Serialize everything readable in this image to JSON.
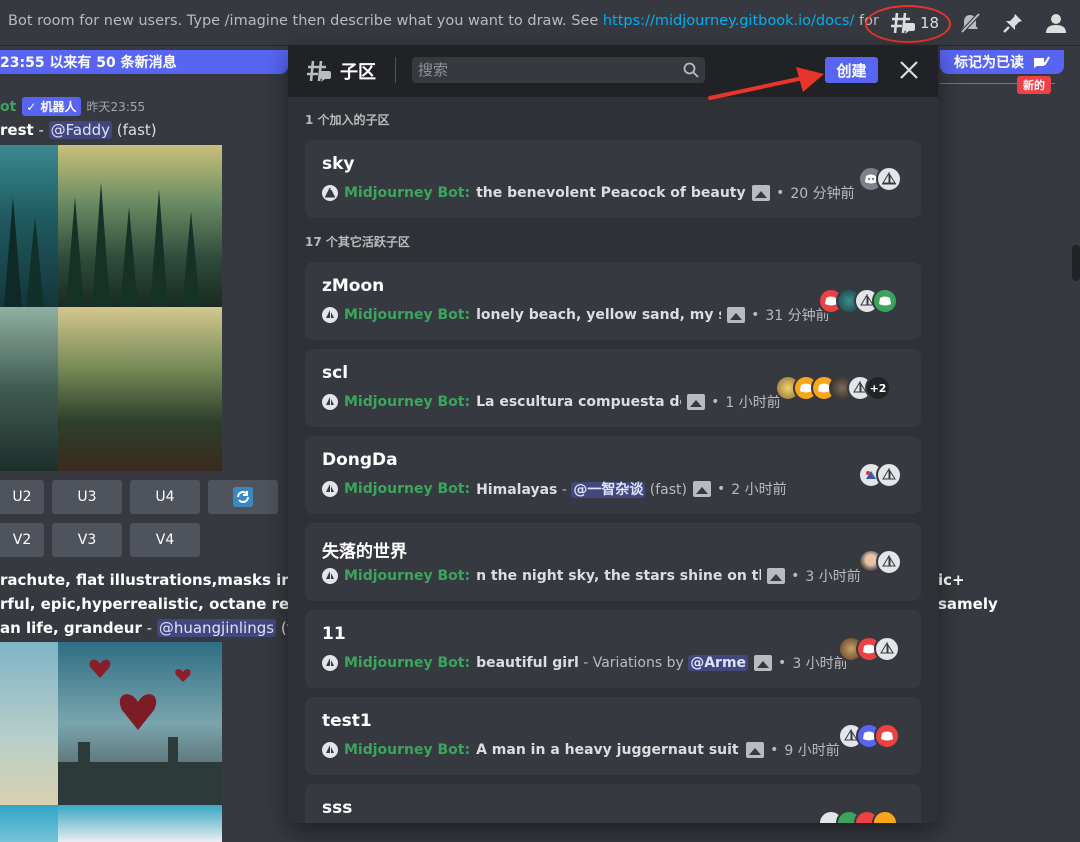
{
  "topbar": {
    "topic_text": "Bot room for new users. Type /imagine then describe what you want to draw. See ",
    "topic_link": "https://midjourney.gitbook.io/docs/",
    "topic_suffix": " for more informat…",
    "thread_count": "18"
  },
  "chat": {
    "new_messages_bar": "23:55 以来有 50 条新消息",
    "mark_read": "标记为已读",
    "new_pill": "新的",
    "author": "ot",
    "bot_tag": "✓ 机器人",
    "timestamp": "昨天23:55",
    "line1_bold": "rest",
    "line1_sep": " - ",
    "line1_mention": "@Faddy",
    "line1_suffix": " (fast)",
    "buttons_row1": [
      "U2",
      "U3",
      "U4"
    ],
    "buttons_row2": [
      "V2",
      "V3",
      "V4"
    ],
    "prompt_line1": "rachute, flat illustrations,masks in the s",
    "prompt_line1_right": "ic+",
    "prompt_line2": "rful, epic,hyperrealistic, octane render,",
    "prompt_line2_right": "samely",
    "prompt_line3_bold": "an life, grandeur",
    "prompt_line3_sep": " - ",
    "prompt_line3_mention": "@huangjinlings",
    "prompt_line3_suffix": " (fast"
  },
  "panel": {
    "title": "子区",
    "search_placeholder": "搜索",
    "create_label": "创建",
    "joined_label": "1 个加入的子区",
    "other_label": "17 个其它活跃子区",
    "bot_name": "Midjourney Bot:",
    "joined": [
      {
        "title": "sky",
        "preview": "the benevolent Peacock of beauty in a",
        "time": "20 分钟前"
      }
    ],
    "threads": [
      {
        "title": "zMoon",
        "preview": "lonely beach, yellow sand, my so",
        "time": "31 分钟前"
      },
      {
        "title": "scl",
        "preview": "La escultura compuesta de (",
        "time": "1 小时前",
        "extra_count": "+2"
      },
      {
        "title": "DongDa",
        "preview": "Himalayas",
        "preview_sep": " - ",
        "preview_mention": "@一智杂谈",
        "preview_suffix": " (fast)",
        "time": "2 小时前"
      },
      {
        "title": "失落的世界",
        "preview": "n the night sky, the stars shine on the s",
        "time": "3 小时前"
      },
      {
        "title": "11",
        "preview": "beautiful girl",
        "preview_muted": " - Variations by ",
        "preview_mention": "@Arme",
        "time": "3 小时前"
      },
      {
        "title": "test1",
        "preview": "A man in a heavy juggernaut suit sta",
        "time": "9 小时前"
      },
      {
        "title": "sss"
      }
    ]
  },
  "colors": {
    "accent": "#5865f2",
    "bot_green": "#3ba55d",
    "annotation_red": "#e8342a",
    "panel_bg": "#2f3136",
    "card_bg": "#36393f"
  },
  "icons": [
    "threads-icon",
    "mute-icon",
    "pin-icon",
    "members-icon",
    "search-icon",
    "close-icon",
    "image-icon",
    "refresh-icon",
    "mark-read-icon",
    "sailboat-avatar-icon",
    "discord-avatar-icon"
  ]
}
